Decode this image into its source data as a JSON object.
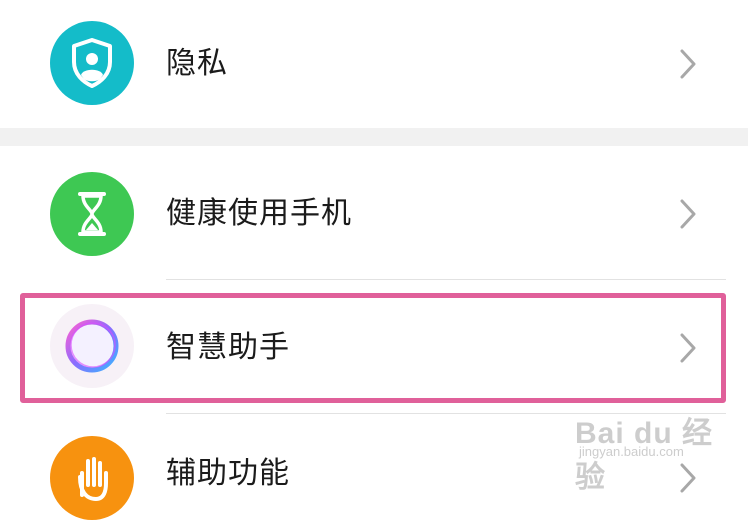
{
  "settings": {
    "items": [
      {
        "label": "隐私",
        "icon": "privacy-shield-user-icon",
        "icon_color": "#14bcc9"
      },
      {
        "label": "健康使用手机",
        "icon": "hourglass-icon",
        "icon_color": "#3ec853"
      },
      {
        "label": "智慧助手",
        "icon": "assistant-ring-icon",
        "icon_color": "#b87cff"
      },
      {
        "label": "辅助功能",
        "icon": "hand-icon",
        "icon_color": "#f7920f"
      }
    ]
  },
  "highlight_color": "#e0609a",
  "watermark": {
    "main": "Bai du 经验",
    "sub": "jingyan.baidu.com"
  }
}
